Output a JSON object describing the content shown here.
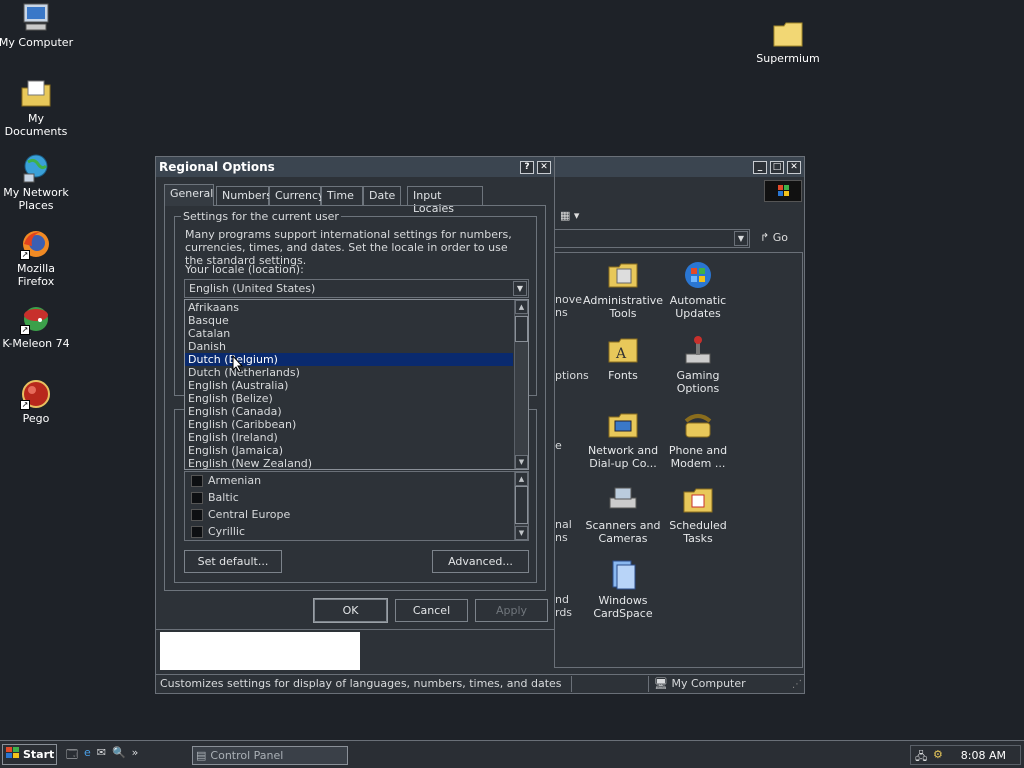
{
  "desktop": {
    "icons": [
      {
        "label": "My Computer"
      },
      {
        "label": "My Documents"
      },
      {
        "label": "My Network Places"
      },
      {
        "label": "Mozilla Firefox"
      },
      {
        "label": "K-Meleon 74"
      },
      {
        "label": "Pego"
      },
      {
        "label": "Supermium"
      }
    ]
  },
  "control_panel": {
    "go_label": "Go",
    "partial_labels": [
      "nove",
      "ns",
      "ptions",
      "e",
      "nal",
      "ns",
      "nd",
      "rds"
    ],
    "icons": [
      {
        "label": "Administrative Tools"
      },
      {
        "label": "Automatic Updates"
      },
      {
        "label": "Fonts"
      },
      {
        "label": "Gaming Options"
      },
      {
        "label": "Network and Dial-up Co..."
      },
      {
        "label": "Phone and Modem ..."
      },
      {
        "label": "Scanners and Cameras"
      },
      {
        "label": "Scheduled Tasks"
      },
      {
        "label": "Windows CardSpace"
      }
    ],
    "status_text": "Customizes settings for display of languages, numbers, times, and dates",
    "status_location": "My Computer"
  },
  "dialog": {
    "title": "Regional Options",
    "help_btn": "?",
    "close_btn": "✕",
    "tabs": [
      "General",
      "Numbers",
      "Currency",
      "Time",
      "Date",
      "Input Locales"
    ],
    "group_title": "Settings for the current user",
    "description": "Many programs support international settings for numbers, currencies, times, and dates. Set the locale in order to use the standard settings.",
    "locale_label": "Your locale (location):",
    "locale_value": "English (United States)",
    "locale_options": [
      "Afrikaans",
      "Basque",
      "Catalan",
      "Danish",
      "Dutch (Belgium)",
      "Dutch (Netherlands)",
      "English (Australia)",
      "English (Belize)",
      "English (Canada)",
      "English (Caribbean)",
      "English (Ireland)",
      "English (Jamaica)",
      "English (New Zealand)"
    ],
    "selected_option": "Dutch (Belgium)",
    "language_settings": [
      "Armenian",
      "Baltic",
      "Central Europe",
      "Cyrillic"
    ],
    "set_default_btn": "Set default...",
    "advanced_btn": "Advanced...",
    "ok_btn": "OK",
    "cancel_btn": "Cancel",
    "apply_btn": "Apply"
  },
  "taskbar": {
    "start_label": "Start",
    "task_label": "Control Panel",
    "quick_more": "»",
    "clock": "8:08 AM"
  }
}
